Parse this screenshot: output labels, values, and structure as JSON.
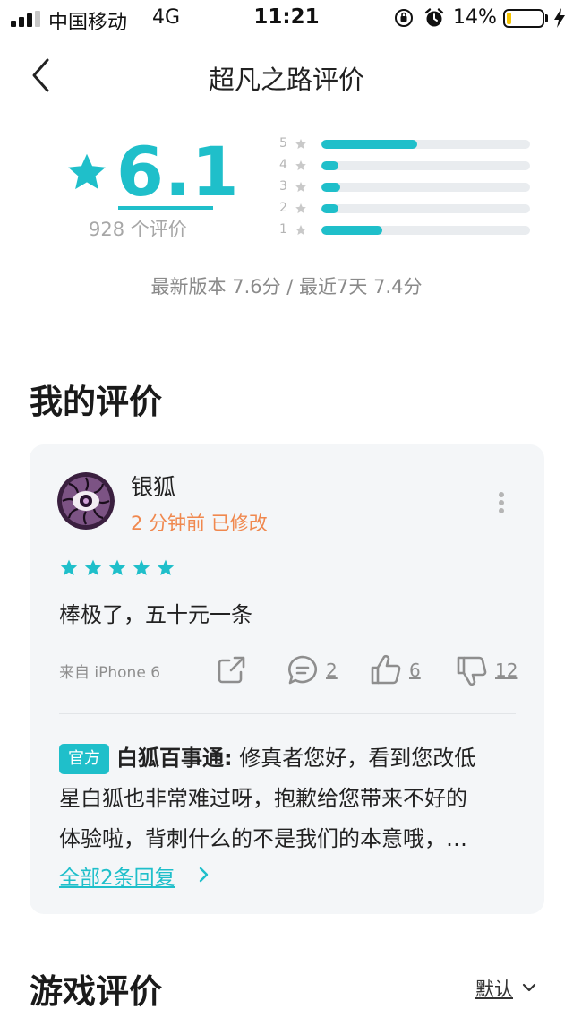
{
  "status_bar": {
    "carrier": "中国移动",
    "network": "4G",
    "time": "11:21",
    "battery_percent": "14%",
    "battery_level": 0.14,
    "signal_bars": 3
  },
  "nav": {
    "title": "超凡之路评价"
  },
  "rating": {
    "score": "6.1",
    "count_label": "928 个评价",
    "distribution": [
      {
        "stars": "5",
        "fraction": 0.46
      },
      {
        "stars": "4",
        "fraction": 0.08
      },
      {
        "stars": "3",
        "fraction": 0.09
      },
      {
        "stars": "2",
        "fraction": 0.08
      },
      {
        "stars": "1",
        "fraction": 0.29
      }
    ],
    "version_line": "最新版本 7.6分 / 最近7天 7.4分"
  },
  "my_review": {
    "section_title": "我的评价",
    "user_name": "银狐",
    "meta": "2 分钟前 已修改",
    "star_count": 5,
    "text": "棒极了，五十元一条",
    "source": "来自 iPhone 6",
    "comments": "2",
    "likes": "6",
    "dislikes": "12",
    "reply": {
      "tag": "官方",
      "author": "白狐百事通:",
      "line1": "修真者您好，看到您改低",
      "line2": "星白狐也非常难过呀，抱歉给您带来不好的",
      "line3": "体验啦，背刺什么的不是我们的本意哦，…"
    },
    "all_replies_label": "全部2条回复"
  },
  "game_reviews": {
    "section_title": "游戏评价",
    "sort_label": "默认"
  },
  "colors": {
    "accent": "#1fbfca",
    "meta_orange": "#f0884e",
    "card_bg": "#f4f6f8",
    "battery_fill": "#f5c400"
  },
  "icons": {
    "back": "chevron-left-icon",
    "star": "star-icon",
    "more": "more-vertical-icon",
    "share": "share-icon",
    "comment": "comment-icon",
    "like": "thumb-up-icon",
    "dislike": "thumb-down-icon",
    "chevron_right": "chevron-right-icon",
    "chevron_down": "chevron-down-icon"
  }
}
